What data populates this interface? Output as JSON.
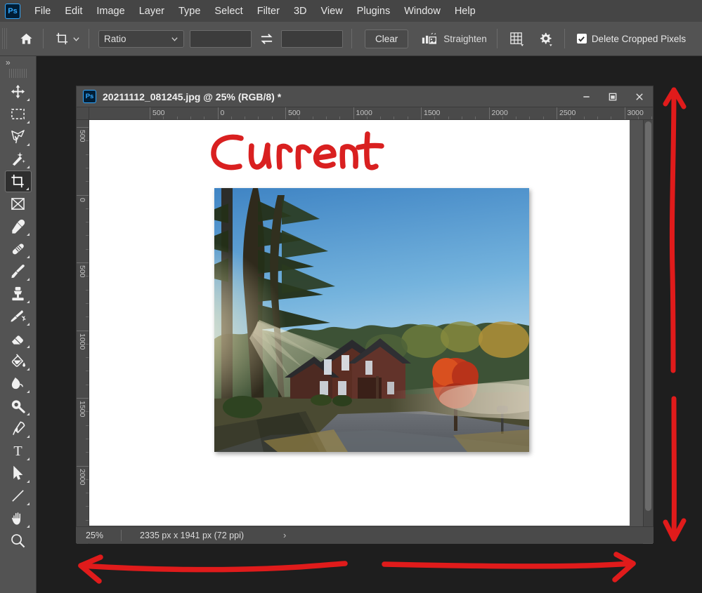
{
  "app": {
    "name": "Adobe Photoshop",
    "logo_text": "Ps"
  },
  "menubar": {
    "items": [
      {
        "label": "File"
      },
      {
        "label": "Edit"
      },
      {
        "label": "Image"
      },
      {
        "label": "Layer"
      },
      {
        "label": "Type"
      },
      {
        "label": "Select"
      },
      {
        "label": "Filter"
      },
      {
        "label": "3D"
      },
      {
        "label": "View"
      },
      {
        "label": "Plugins"
      },
      {
        "label": "Window"
      },
      {
        "label": "Help"
      }
    ]
  },
  "options_bar": {
    "home_icon": "home-icon",
    "tool_icon": "crop-tool-icon",
    "tool_dropdown_icon": "chevron-down-icon",
    "ratio_select": {
      "value": "Ratio",
      "icon": "chevron-down-icon"
    },
    "width_field": {
      "value": "",
      "placeholder": ""
    },
    "swap_icon": "swap-arrows-icon",
    "height_field": {
      "value": "",
      "placeholder": ""
    },
    "clear_button": "Clear",
    "straighten_icon": "straighten-icon",
    "straighten_label": "Straighten",
    "overlay_icon": "grid-overlay-icon",
    "settings_icon": "gear-icon",
    "delete_cropped": {
      "label": "Delete Cropped Pixels",
      "checked": true,
      "check_glyph": "✓"
    }
  },
  "toolbar": {
    "expand_glyph": "»",
    "tools": [
      {
        "name": "move-tool",
        "title": "Move Tool",
        "has_corner": true,
        "active": false
      },
      {
        "name": "rectangular-marquee-tool",
        "title": "Rectangular Marquee Tool",
        "has_corner": true,
        "active": false
      },
      {
        "name": "lasso-tool",
        "title": "Lasso Tool",
        "has_corner": true,
        "active": false
      },
      {
        "name": "magic-wand-tool",
        "title": "Object Selection Tool",
        "has_corner": true,
        "active": false
      },
      {
        "name": "crop-tool",
        "title": "Crop Tool",
        "has_corner": true,
        "active": true
      },
      {
        "name": "frame-tool",
        "title": "Frame Tool",
        "has_corner": false,
        "active": false
      },
      {
        "name": "eyedropper-tool",
        "title": "Eyedropper Tool",
        "has_corner": true,
        "active": false
      },
      {
        "name": "healing-brush-tool",
        "title": "Spot Healing Brush Tool",
        "has_corner": true,
        "active": false
      },
      {
        "name": "brush-tool",
        "title": "Brush Tool",
        "has_corner": true,
        "active": false
      },
      {
        "name": "clone-stamp-tool",
        "title": "Clone Stamp Tool",
        "has_corner": true,
        "active": false
      },
      {
        "name": "history-brush-tool",
        "title": "History Brush Tool",
        "has_corner": true,
        "active": false
      },
      {
        "name": "eraser-tool",
        "title": "Eraser Tool",
        "has_corner": true,
        "active": false
      },
      {
        "name": "gradient-tool",
        "title": "Gradient Tool",
        "has_corner": true,
        "active": false
      },
      {
        "name": "blur-tool",
        "title": "Blur Tool",
        "has_corner": true,
        "active": false
      },
      {
        "name": "dodge-tool",
        "title": "Dodge Tool",
        "has_corner": true,
        "active": false
      },
      {
        "name": "pen-tool",
        "title": "Pen Tool",
        "has_corner": true,
        "active": false
      },
      {
        "name": "type-tool",
        "title": "Horizontal Type Tool",
        "has_corner": true,
        "active": false
      },
      {
        "name": "path-selection-tool",
        "title": "Path Selection Tool",
        "has_corner": true,
        "active": false
      },
      {
        "name": "line-tool",
        "title": "Line Tool",
        "has_corner": true,
        "active": false
      },
      {
        "name": "hand-tool",
        "title": "Hand Tool",
        "has_corner": true,
        "active": false
      },
      {
        "name": "zoom-tool",
        "title": "Zoom Tool",
        "has_corner": false,
        "active": false
      }
    ]
  },
  "document_window": {
    "title": "20211112_081245.jpg @ 25% (RGB/8) *",
    "logo_text": "Ps",
    "minimize_glyph": "—",
    "maximize_glyph": "❐",
    "close_glyph": "✕",
    "ruler_horizontal": {
      "labels": [
        "500",
        "0",
        "500",
        "1000",
        "1500",
        "2000",
        "2500",
        "3000"
      ]
    },
    "ruler_vertical": {
      "labels": [
        "500",
        "0",
        "500",
        "1000",
        "1500",
        "2000"
      ]
    },
    "canvas_annotation_text": "Current"
  },
  "status_bar": {
    "zoom": "25%",
    "dimensions": "2335 px x 1941 px (72 ppi)",
    "chevron_glyph": "›"
  },
  "annotations": {
    "vertical_arrow": "vertical-double-arrow-annotation",
    "horizontal_arrow": "horizontal-double-arrow-annotation",
    "handwritten_label": "Current"
  },
  "colors": {
    "menubar_bg": "#454545",
    "options_bg": "#535353",
    "panel_bg": "#535353",
    "canvas_bg": "#262626",
    "annotation_red": "#e01b1b",
    "accent_blue": "#31a8ff"
  }
}
